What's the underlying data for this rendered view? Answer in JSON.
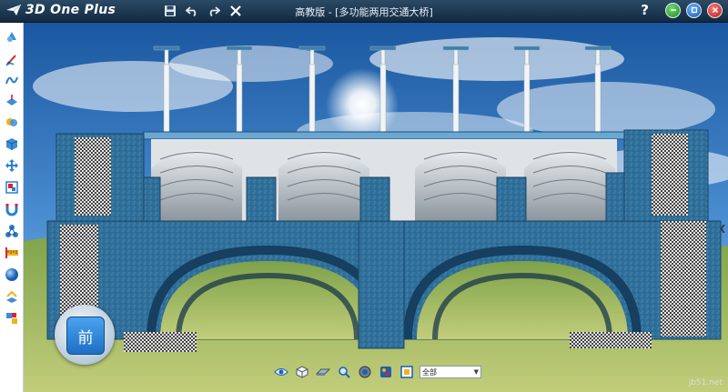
{
  "app": {
    "name": "3D One Plus",
    "window_title": "高教版 - [多功能两用交通大桥]"
  },
  "titlebar": {
    "tools": [
      "save-icon",
      "undo-icon",
      "redo-icon",
      "close-x-icon"
    ],
    "help_label": "?"
  },
  "sidebar": {
    "items": [
      "basic-solid-icon",
      "sketch-icon",
      "edit-curve-icon",
      "feature-icon",
      "combine-icon",
      "cube-icon",
      "move-icon",
      "texture-icon",
      "magnet-icon",
      "special-function-icon",
      "measure-icon",
      "sphere-icon",
      "material-icon",
      "assembly-icon"
    ]
  },
  "view_cube": {
    "label": "前"
  },
  "bottom_toolbar": {
    "tools": [
      "eye-icon",
      "view-cube-icon",
      "view-plane-icon",
      "zoom-icon",
      "render-icon",
      "palette-icon",
      "frame-icon"
    ],
    "filter_value": "全部"
  },
  "watermark": "jb51.net",
  "colors": {
    "titlebar": "#1b3550",
    "bridge": "#2f6f99",
    "sky_top": "#1e5fa8",
    "grass": "#9ab85a"
  }
}
